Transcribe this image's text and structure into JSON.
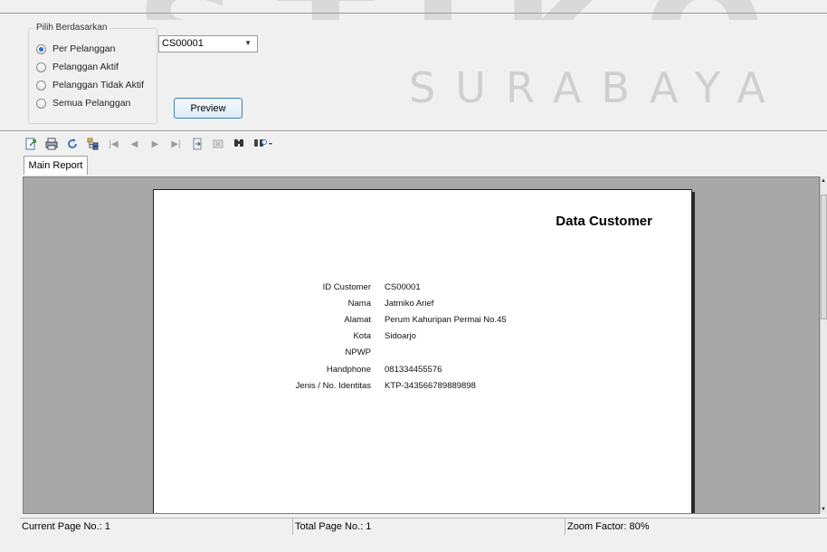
{
  "watermark": {
    "top_text": "STIKOM",
    "sub_text": "SURABAYA"
  },
  "filter": {
    "group_title": "Pilih Berdasarkan",
    "options": [
      {
        "label": "Per Pelanggan",
        "selected": true
      },
      {
        "label": "Pelanggan Aktif",
        "selected": false
      },
      {
        "label": "Pelanggan Tidak Aktif",
        "selected": false
      },
      {
        "label": "Semua Pelanggan",
        "selected": false
      }
    ],
    "customer_select": "CS00001",
    "preview_label": "Preview"
  },
  "toolbar": {
    "icons": [
      "export-icon",
      "print-icon",
      "refresh-icon",
      "group-tree-icon",
      "first-page-icon",
      "previous-page-icon",
      "next-page-icon",
      "last-page-icon",
      "goto-page-icon",
      "stop-icon",
      "search-icon",
      "zoom-icon"
    ]
  },
  "tab": {
    "label": "Main Report"
  },
  "report": {
    "title": "Data Customer",
    "fields": [
      {
        "label": "ID Customer",
        "value": "CS00001"
      },
      {
        "label": "Nama",
        "value": "Jatmiko Arief"
      },
      {
        "label": "Alamat",
        "value": "Perum Kahuripan Permai No.45"
      },
      {
        "label": "Kota",
        "value": "Sidoarjo"
      },
      {
        "label": "NPWP",
        "value": ""
      },
      {
        "label": "Handphone",
        "value": "081334455576"
      },
      {
        "label": "Jenis / No. Identitas",
        "value": "KTP-343566789889898"
      }
    ]
  },
  "status": {
    "current_page": "Current Page No.: 1",
    "total_page": "Total Page No.: 1",
    "zoom": "Zoom Factor: 80%"
  }
}
